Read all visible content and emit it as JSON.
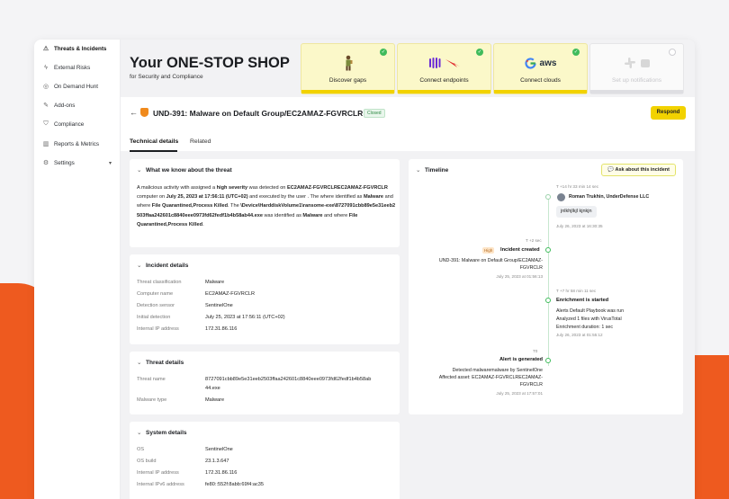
{
  "sidebar": {
    "items": [
      {
        "label": "Threats & Incidents",
        "icon": "warning-icon",
        "active": true
      },
      {
        "label": "External Risks",
        "icon": "flash-icon"
      },
      {
        "label": "On Demand Hunt",
        "icon": "target-icon"
      },
      {
        "label": "Add-ons",
        "icon": "wrench-icon"
      },
      {
        "label": "Compliance",
        "icon": "shield-outline-icon"
      },
      {
        "label": "Reports & Metrics",
        "icon": "chart-icon"
      },
      {
        "label": "Settings",
        "icon": "gear-icon",
        "chevron": "▾"
      }
    ]
  },
  "hero": {
    "title": "Your ONE-STOP SHOP",
    "subtitle": "for Security and Compliance"
  },
  "cards": [
    {
      "label": "Discover gaps",
      "done": true,
      "art": "explorer-icon"
    },
    {
      "label": "Connect endpoints",
      "done": true,
      "art": "endpoint-logos-icon"
    },
    {
      "label": "Connect clouds",
      "done": true,
      "art": "cloud-logos-icon",
      "logo_text": "aws"
    },
    {
      "label": "Set up notifications",
      "done": false,
      "art": "slack-icon"
    }
  ],
  "incident": {
    "title": "UND-391: Malware on Default Group/EC2AMAZ-FGVRCLR",
    "status": "Closed",
    "respond_label": "Respond",
    "back_icon": "←",
    "tabs": [
      "Technical details",
      "Related"
    ],
    "what_we_know": {
      "heading": "What we know about the threat",
      "p1": "A malicious activity with assigned a ",
      "p1_bold": "high severity",
      "p2": " was detected on ",
      "p2_bold": "EC2AMAZ-FGVRCLREC2AMAZ-FGVRCLR",
      "p3": " computer on ",
      "p3_bold": "July 25, 2023 at 17:56:11 (UTC+02)",
      "p4": " and executed by the user . The where identified as ",
      "p4_bold": "Malware",
      "p5": " and where ",
      "p5_bold": "File Quarantined,Process Killed",
      "p6": ". The ",
      "p6_bold": "\\Device\\HarddiskVolume1\\ransome-exe\\8727091cbb89e5e31eeb2503ffaa242601c8840eee0973fd62fedf1b4b58ab44.exe",
      "p7": " was identified as ",
      "p7_bold": "Malware",
      "p8": " and where ",
      "p8_bold": "File Quarantined,Process Killed",
      "p9": "."
    },
    "incident_details": {
      "heading": "Incident details",
      "rows": [
        {
          "k": "Threat classification",
          "v": "Malware"
        },
        {
          "k": "Computer name",
          "v": "EC2AMAZ-FGVRCLR"
        },
        {
          "k": "Detection sensor",
          "v": "SentinelOne"
        },
        {
          "k": "Initial detection",
          "v": "July 25, 2023 at 17:56:11 (UTC+02)"
        },
        {
          "k": "Internal IP address",
          "v": "172.31.86.116"
        }
      ]
    },
    "threat_details": {
      "heading": "Threat details",
      "rows": [
        {
          "k": "Threat name",
          "v": "8727091cbb89e5e31eeb2503ffaa242601c8840eee0973fd62fedf1b4b58ab",
          "v2": "44.exe"
        },
        {
          "k": "Malware type",
          "v": "Malware"
        }
      ]
    },
    "system_details": {
      "heading": "System details",
      "rows": [
        {
          "k": "OS",
          "v": "SentinelOne"
        },
        {
          "k": "OS build",
          "v": "23.1.3.647"
        },
        {
          "k": "Internal IP address",
          "v": "172.31.86.116"
        },
        {
          "k": "Internal IPv6 address",
          "v": "fe80::552f:8abb:69f4:ac35"
        }
      ]
    },
    "timeline": {
      "heading": "Timeline",
      "ask_label": "Ask about this incident",
      "events": [
        {
          "meta": "T +14 hr 33 min 14 sec",
          "author": "Roman Trukhin, UnderDefense LLC",
          "comment": "jnlkhjlkjl kjnkjn",
          "time": "July 26, 2023 at 16:30:35"
        },
        {
          "meta": "T +2 sec",
          "badge": "High",
          "title": "Incident created",
          "text": "UND-391: Malware on Default Group/EC2AMAZ-",
          "text2": "FGVRCLR",
          "time": "July 25, 2023 at 01:56:13"
        },
        {
          "meta": "T +7 hr 58 min 11 sec",
          "title": "Enrichment is started",
          "text": "Alerts Default Playbook was run",
          "text2": "Analyzed 1 files with VirusTotal",
          "text3": "Enrichment duration: 1 sec",
          "time": "July 26, 2023 at 01:55:12"
        },
        {
          "meta": "T0",
          "title": "Alert is generated",
          "text": "Detected malwaremalware by SentinelOne",
          "text2": "Affected asset: EC2AMAZ-FGVRCLREC2AMAZ-",
          "text3": "FGVRCLR",
          "time": "July 25, 2023 at 17:57:01"
        }
      ]
    }
  }
}
